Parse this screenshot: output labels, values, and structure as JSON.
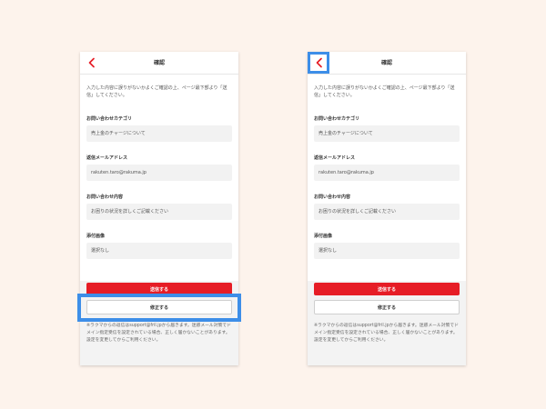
{
  "colors": {
    "page_bg": "#fdf3ec",
    "accent_red": "#e61d26",
    "highlight_blue": "#3d8ee8"
  },
  "screens": [
    {
      "highlight": "fix-button",
      "header": {
        "title": "確認",
        "back_icon": "chevron-left-icon"
      },
      "intro": "入力した内容に誤りがないかよくご確認の上、ページ最下部より「送信」してください。",
      "fields": [
        {
          "label": "お問い合わせカテゴリ",
          "value": "売上金のチャージについて"
        },
        {
          "label": "返信メールアドレス",
          "value": "rakuten.taro@rakuma.jp"
        },
        {
          "label": "お問い合わせ内容",
          "value": "お困りの状況を詳しくご記載ください"
        },
        {
          "label": "添付画像",
          "value": "選択なし"
        }
      ],
      "send_label": "送信する",
      "fix_label": "修正する",
      "note": "※ラクマからの返信はsupport@fril.jpから届きます。迷惑メール対策でドメイン指定受信を設定されている場合、正しく届かないことがあります。設定を変更してからご利用ください。"
    },
    {
      "highlight": "back-button",
      "header": {
        "title": "確認",
        "back_icon": "chevron-left-icon"
      },
      "intro": "入力した内容に誤りがないかよくご確認の上、ページ最下部より「送信」してください。",
      "fields": [
        {
          "label": "お問い合わせカテゴリ",
          "value": "売上金のチャージについて"
        },
        {
          "label": "返信メールアドレス",
          "value": "rakuten.taro@rakuma.jp"
        },
        {
          "label": "お問い合わせ内容",
          "value": "お困りの状況を詳しくご記載ください"
        },
        {
          "label": "添付画像",
          "value": "選択なし"
        }
      ],
      "send_label": "送信する",
      "fix_label": "修正する",
      "note": "※ラクマからの返信はsupport@fril.jpから届きます。迷惑メール対策でドメイン指定受信を設定されている場合、正しく届かないことがあります。設定を変更してからご利用ください。"
    }
  ]
}
